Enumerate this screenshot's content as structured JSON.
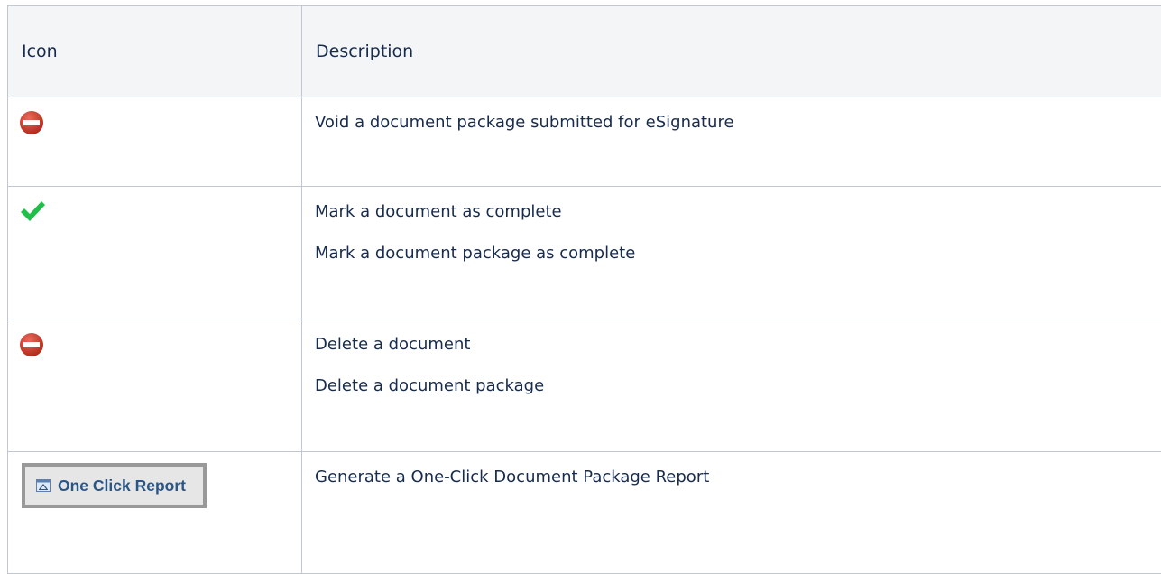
{
  "table": {
    "headers": {
      "icon": "Icon",
      "description": "Description"
    },
    "rows": [
      {
        "icon": "void-stop-icon",
        "descriptions": [
          "Void a document package submitted for eSignature"
        ]
      },
      {
        "icon": "green-checkmark-icon",
        "descriptions": [
          "Mark a document as complete",
          "Mark a document package as complete"
        ]
      },
      {
        "icon": "delete-stop-icon",
        "descriptions": [
          "Delete a document",
          "Delete a document package"
        ]
      },
      {
        "icon": "report-icon",
        "button_label": "One Click Report",
        "descriptions": [
          "Generate a One-Click Document Package Report"
        ]
      }
    ]
  },
  "colors": {
    "border": "#c1c7d0",
    "header_bg": "#f4f5f7",
    "text": "#172b4d",
    "stop_red": "#c0392b",
    "check_green": "#1fbf4a",
    "button_text": "#2a5685"
  }
}
